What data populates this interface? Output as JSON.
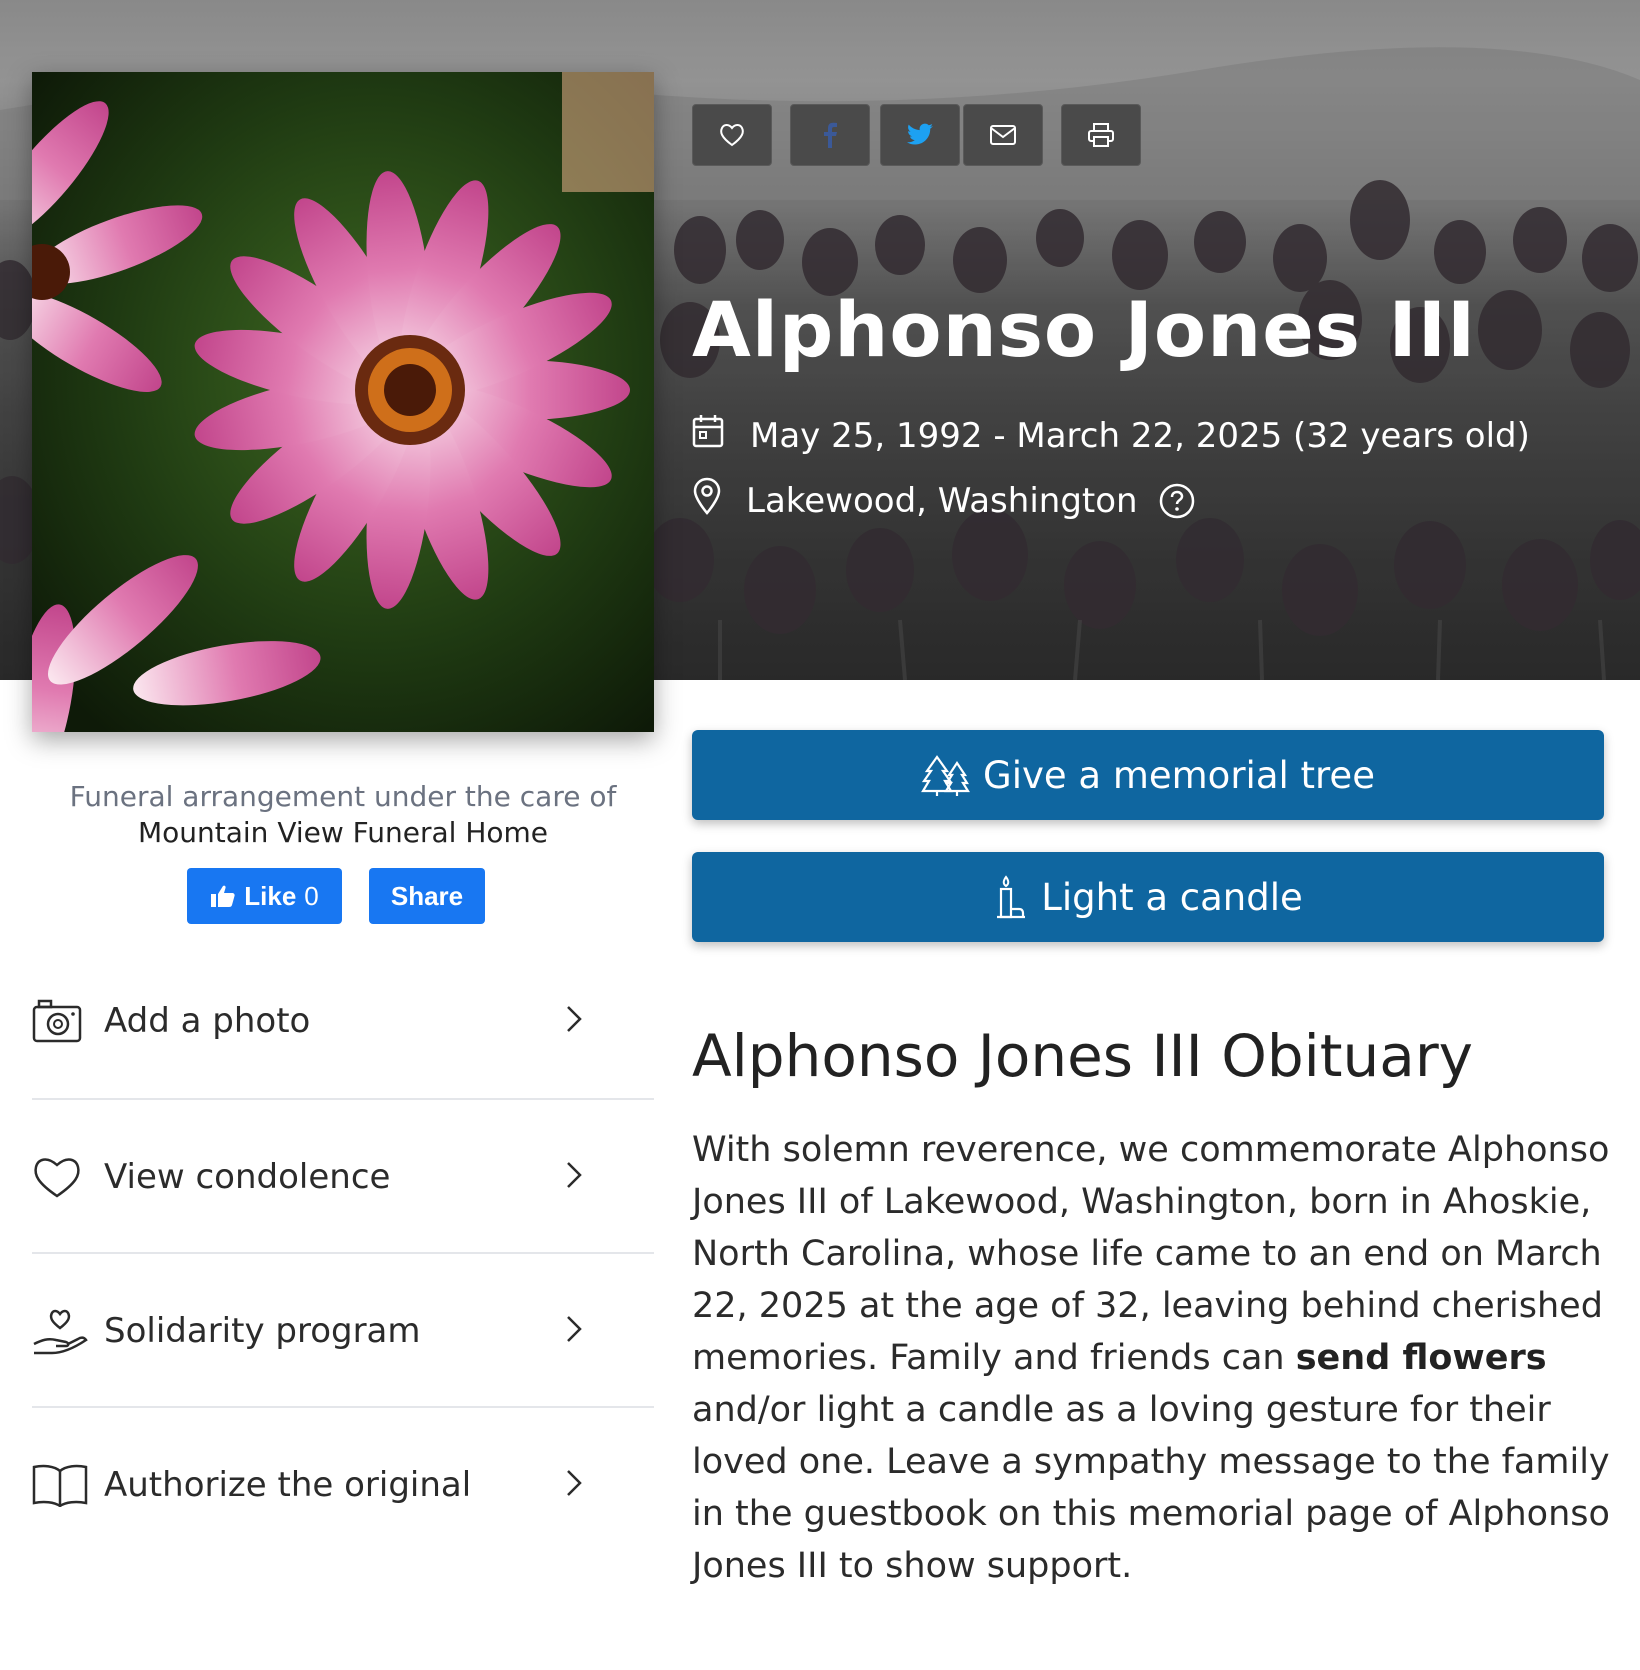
{
  "share_bar": {
    "icons": [
      "heart-icon",
      "facebook-icon",
      "twitter-icon",
      "email-icon",
      "print-icon"
    ]
  },
  "deceased": {
    "name": "Alphonso Jones III",
    "dates": "May 25, 1992 - March 22, 2025 (32 years old)",
    "location": "Lakewood, Washington"
  },
  "care": {
    "line1": "Funeral arrangement under the care of",
    "funeral_home": "Mountain View Funeral Home"
  },
  "facebook": {
    "like_label": "Like",
    "like_count": "0",
    "share_label": "Share"
  },
  "sidebar": {
    "items": [
      {
        "label": "Add a photo",
        "icon": "camera-icon"
      },
      {
        "label": "View condolence",
        "icon": "heart-icon"
      },
      {
        "label": "Solidarity program",
        "icon": "hand-heart-icon"
      },
      {
        "label": "Authorize the original",
        "icon": "book-icon"
      }
    ]
  },
  "actions": {
    "tree_label": "Give a memorial tree",
    "candle_label": "Light a candle"
  },
  "obituary": {
    "title": "Alphonso Jones III Obituary",
    "text_before": "With solemn reverence, we commemorate Alphonso Jones III of Lakewood, Washington, born in Ahoskie, North Carolina, whose life came to an end on March 22, 2025 at the age of 32, leaving behind cherished memories. Family and friends can ",
    "link_text": "send flowers",
    "text_after": " and/or light a candle as a loving gesture for their loved one. Leave a sympathy message to the family in the guestbook on this memorial page of Alphonso Jones III to show support."
  },
  "colors": {
    "accent": "#0f66a0",
    "facebook": "#1877f2",
    "icon_button": "#4a4a4a"
  }
}
